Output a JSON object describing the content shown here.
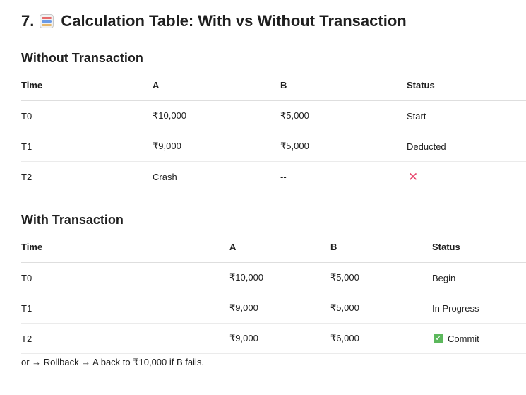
{
  "title": {
    "number": "7.",
    "text": "Calculation Table: With vs Without Transaction",
    "icon": "abacus-icon"
  },
  "without": {
    "heading": "Without Transaction",
    "headers": [
      "Time",
      "A",
      "B",
      "Status"
    ],
    "rows": [
      [
        "T0",
        "₹10,000",
        "₹5,000",
        "Start"
      ],
      [
        "T1",
        "₹9,000",
        "₹5,000",
        "Deducted"
      ],
      [
        "T2",
        "Crash",
        "--",
        ""
      ]
    ],
    "crash_status_icon": "cross-mark-icon"
  },
  "with": {
    "heading": "With Transaction",
    "headers": [
      "Time",
      "A",
      "B",
      "Status"
    ],
    "rows": [
      [
        "T0",
        "₹10,000",
        "₹5,000",
        "Begin"
      ],
      [
        "T1",
        "₹9,000",
        "₹5,000",
        "In Progress"
      ],
      [
        "T2",
        "₹9,000",
        "₹6,000",
        "Commit"
      ]
    ],
    "commit_status_icon": "check-mark-icon"
  },
  "footnote": "or → Rollback → A back to ₹10,000 if B fails.",
  "colors": {
    "cross": "#e8466d",
    "check": "#5cb85c"
  }
}
